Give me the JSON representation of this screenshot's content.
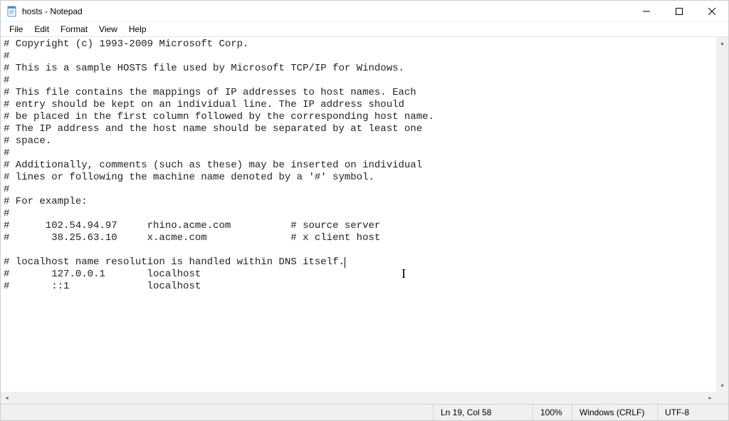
{
  "window": {
    "title": "hosts - Notepad"
  },
  "menu": {
    "file": "File",
    "edit": "Edit",
    "format": "Format",
    "view": "View",
    "help": "Help"
  },
  "content": "# Copyright (c) 1993-2009 Microsoft Corp.\n#\n# This is a sample HOSTS file used by Microsoft TCP/IP for Windows.\n#\n# This file contains the mappings of IP addresses to host names. Each\n# entry should be kept on an individual line. The IP address should\n# be placed in the first column followed by the corresponding host name.\n# The IP address and the host name should be separated by at least one\n# space.\n#\n# Additionally, comments (such as these) may be inserted on individual\n# lines or following the machine name denoted by a '#' symbol.\n#\n# For example:\n#\n#      102.54.94.97     rhino.acme.com          # source server\n#       38.25.63.10     x.acme.com              # x client host\n\n# localhost name resolution is handled within DNS itself.",
  "content_tail": "\n#       127.0.0.1       localhost\n#       ::1             localhost",
  "status": {
    "position": "Ln 19, Col 58",
    "zoom": "100%",
    "line_ending": "Windows (CRLF)",
    "encoding": "UTF-8"
  }
}
